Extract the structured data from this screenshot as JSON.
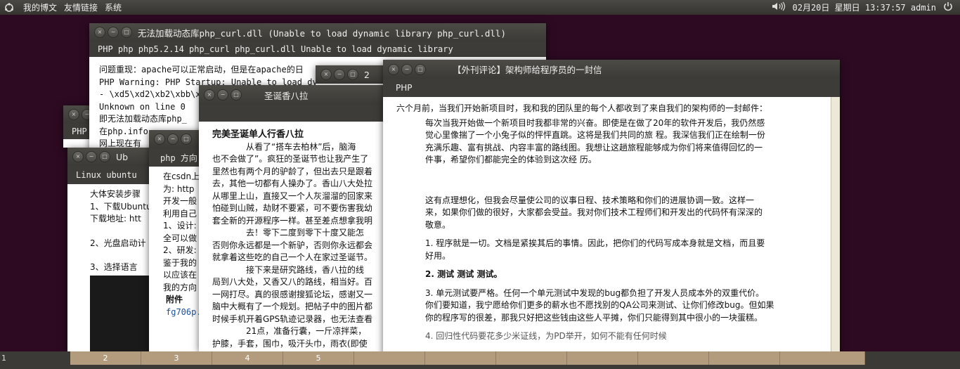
{
  "top_panel": {
    "menus": [
      "我的博文",
      "友情链接",
      "系统"
    ],
    "volume_icon": "speaker-icon",
    "datetime": "02月20日 星期日 13:37:57 admin",
    "power_icon": "power-icon"
  },
  "windows": {
    "php_curl": {
      "title": "无法加载动态库php_curl.dll (Unable to load dynamic library php_curl.dll)",
      "tags": "PHP php php5.2.14 php_curl php_curl.dll Unable to load dynamic library",
      "lines": [
        "问题重现：apache可以正常启动，但是在apache的日",
        "PHP Warning:  PHP Startup: Unable to load dynamic",
        "- \\xd5\\xd2\\xb2\\xbb\\x",
        "Unknown on line 0",
        "即无法加载动态库php_",
        "在php.info",
        "网上现在有"
      ]
    },
    "ubuntu_small": {
      "tag": "PHP"
    },
    "ubuntu": {
      "title": "Ub",
      "tag": "Linux ubuntu",
      "lines": [
        "大体安装步骤",
        "1、下载Ubuntu",
        "下载地址: htt",
        "",
        "2、光盘启动计",
        "",
        "3、选择语言"
      ]
    },
    "php_dir": {
      "title": "php 方向",
      "lines": [
        "在csdn上",
        "为: http",
        "开发一般",
        "利用自己",
        "1、设计:",
        "全可以做",
        "2、研发:",
        "鉴于我的",
        "以应该在",
        "我的方向"
      ],
      "attach_label": "附件",
      "attach_link": "fg706p."
    },
    "christmas": {
      "title": "圣诞香八拉",
      "heading": "完美圣诞单人行香八拉",
      "lines": [
        "　　　　从看了“搭车去柏林”后，脑海",
        "也不会做了”。疯狂的圣诞节也让我产生了",
        "里然也有两个月的驴龄了，但出去只是跟着",
        "去，其他一切都有人操办了。香山八大处拉",
        "从哪里上山，直接又一个人灰溜溜的回家来",
        "怕碰到山贼，劫财不要紧，可不要伤害我幼",
        "套全新的开源程序一样。甚至差点想拿我明",
        "　　　　去！零下二度到零下十度又能怎",
        "否则你永远都是一个新驴，否则你永远都会",
        "就拿着这些吃的自己一个人在家过圣诞节。",
        "　　　　接下来是研究路线，香八拉的线",
        "局到八大处，又香又八的路线，相当好。百",
        "一网打尽。真的很感谢搜狐论坛，感谢又一",
        "脑中大概有了一个规划。把帖子中的图片都",
        "时候手机开着GPS轨迹记录器，也无法查看",
        "　　　　21点，准备行囊，一斤凉拌菜，",
        "护膝，手套，围巾，吸汗头巾，雨衣(即使"
      ]
    },
    "small_2": {
      "title": "2"
    },
    "letter": {
      "title": "【外刊评论】架构师给程序员的一封信",
      "tag": "PHP",
      "intro": "六个月前，当我们开始新项目时，我和我的团队里的每个人都收到了来自我们的架构师的一封邮件：",
      "quote": [
        "每次当我开始做一个新项目时我都非常的兴奋。即使是在做了20年的软件开发后，我仍然感",
        "觉心里像揣了一个小兔子似的怦怦直跳。这将是我们共同的旅 程。我深信我们正在绘制一份",
        "充满乐趣、富有挑战、内容丰富的路线图。我想让这趟旅程能够成为你们将来值得回忆的一",
        "件事，希望你们都能完全的体验到这次经 历。"
      ],
      "p2": [
        "这有点理想化，但我会尽量使公司的议事日程、技术策略和你们的进展协调一致。这样一",
        "来，如果你们做的很好，大家都会受益。我对你们技术工程师们和开发出的代码怀有深深的",
        "敬意。"
      ],
      "p3": [
        "1. 程序就是一切。文档是紧挨其后的事情。因此，把你们的代码写成本身就是文档，而且要",
        "好用。"
      ],
      "p4": "2. 测试 测试 测试。",
      "p5": [
        "3. 单元测试要严格。任何一个单元测试中发现的bug都负担了开发人员成本外的双重代价。",
        "你们要知道，我宁愿给你们更多的薪水也不愿找别的QA公司来测试、让你们修改bug。但如果",
        "你的程序写的很差，那我只好把这些钱由这些人平摊，你们只能得到其中很小的一块蛋糕。"
      ],
      "p6": "4. 回归性代码要花多少米证线，为PD举开，如何不能有任何时候"
    }
  },
  "bottom_panel": {
    "workspaces": [
      "1",
      "2",
      "3",
      "4",
      "5",
      "",
      "",
      "",
      "",
      "",
      "",
      ""
    ]
  }
}
